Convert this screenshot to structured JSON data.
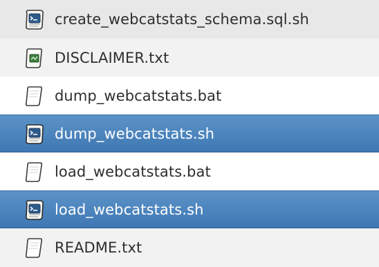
{
  "files": [
    {
      "name": "create_webcatstats_schema.sql.sh",
      "icon": "script-icon",
      "selected": false
    },
    {
      "name": "DISCLAIMER.txt",
      "icon": "text-doc-icon",
      "selected": false
    },
    {
      "name": "dump_webcatstats.bat",
      "icon": "blank-doc-icon",
      "selected": false
    },
    {
      "name": "dump_webcatstats.sh",
      "icon": "script-icon",
      "selected": true
    },
    {
      "name": "load_webcatstats.bat",
      "icon": "blank-doc-icon",
      "selected": false
    },
    {
      "name": "load_webcatstats.sh",
      "icon": "script-icon",
      "selected": true
    },
    {
      "name": "README.txt",
      "icon": "blank-doc-icon",
      "selected": false
    }
  ],
  "colors": {
    "selection": "#4a84bf",
    "row_alt": "#f2f2f2",
    "text": "#2e2e2e",
    "selected_text": "#ffffff"
  }
}
